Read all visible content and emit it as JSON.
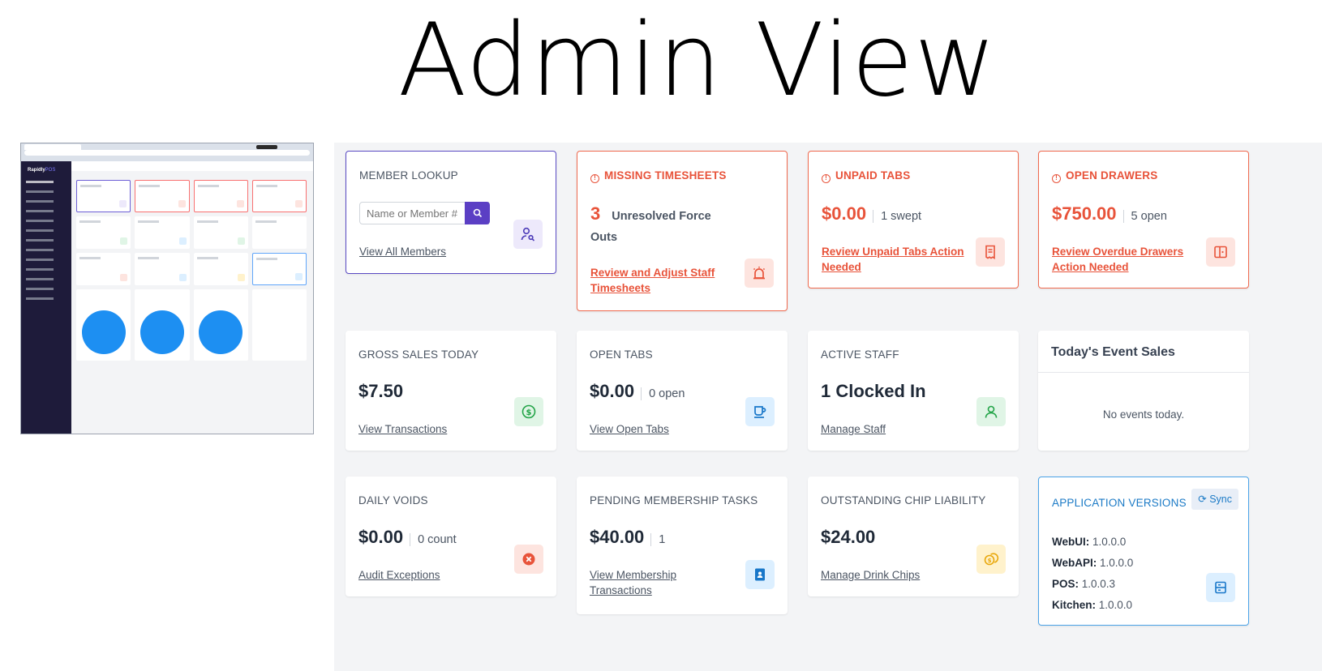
{
  "heading": "Admin View",
  "thumbnail": {
    "logo_main": "Rapidly",
    "logo_accent": "POS"
  },
  "cards": {
    "member_lookup": {
      "title": "MEMBER LOOKUP",
      "search_placeholder": "Name or Member #",
      "link": "View All Members",
      "icon": "user-search-icon"
    },
    "missing_timesheets": {
      "title": "MISSING TIMESHEETS",
      "value": "3",
      "sub": "Unresolved Force",
      "sub2": "Outs",
      "link": "Review and Adjust Staff Timesheets",
      "icon": "alarm-icon"
    },
    "unpaid_tabs": {
      "title": "UNPAID TABS",
      "value": "$0.00",
      "sub": "1 swept",
      "link": "Review Unpaid Tabs Action Needed",
      "icon": "receipt-icon"
    },
    "open_drawers": {
      "title": "OPEN DRAWERS",
      "value": "$750.00",
      "sub": "5 open",
      "link": "Review Overdue Drawers Action Needed",
      "icon": "drawer-icon"
    },
    "gross_sales": {
      "title": "GROSS SALES TODAY",
      "value": "$7.50",
      "link": "View Transactions",
      "icon": "dollar-icon"
    },
    "open_tabs": {
      "title": "OPEN TABS",
      "value": "$0.00",
      "sub": "0 open",
      "link": "View Open Tabs",
      "icon": "cup-icon"
    },
    "active_staff": {
      "title": "ACTIVE STAFF",
      "value": "1 Clocked In",
      "link": "Manage Staff",
      "icon": "user-icon"
    },
    "event_sales": {
      "title": "Today's Event Sales",
      "empty": "No events today."
    },
    "daily_voids": {
      "title": "DAILY VOIDS",
      "value": "$0.00",
      "sub": "0 count",
      "link": "Audit Exceptions",
      "icon": "x-circle-icon"
    },
    "membership_tasks": {
      "title": "PENDING MEMBERSHIP TASKS",
      "value": "$40.00",
      "sub": "1",
      "link": "View Membership Transactions",
      "icon": "member-card-icon"
    },
    "chip_liability": {
      "title": "OUTSTANDING CHIP LIABILITY",
      "value": "$24.00",
      "link": "Manage Drink Chips",
      "icon": "coins-icon"
    },
    "app_versions": {
      "title": "APPLICATION VERSIONS",
      "sync": "Sync",
      "rows": [
        {
          "label": "WebUI:",
          "value": "1.0.0.0"
        },
        {
          "label": "WebAPI:",
          "value": "1.0.0.0"
        },
        {
          "label": "POS:",
          "value": "1.0.0.3"
        },
        {
          "label": "Kitchen:",
          "value": "1.0.0.0"
        }
      ],
      "icon": "server-icon"
    }
  },
  "colors": {
    "accent_purple": "#5b3fc4",
    "alert_red": "#e8533a",
    "info_blue": "#1b7ac6",
    "background": "#f3f4f6"
  }
}
